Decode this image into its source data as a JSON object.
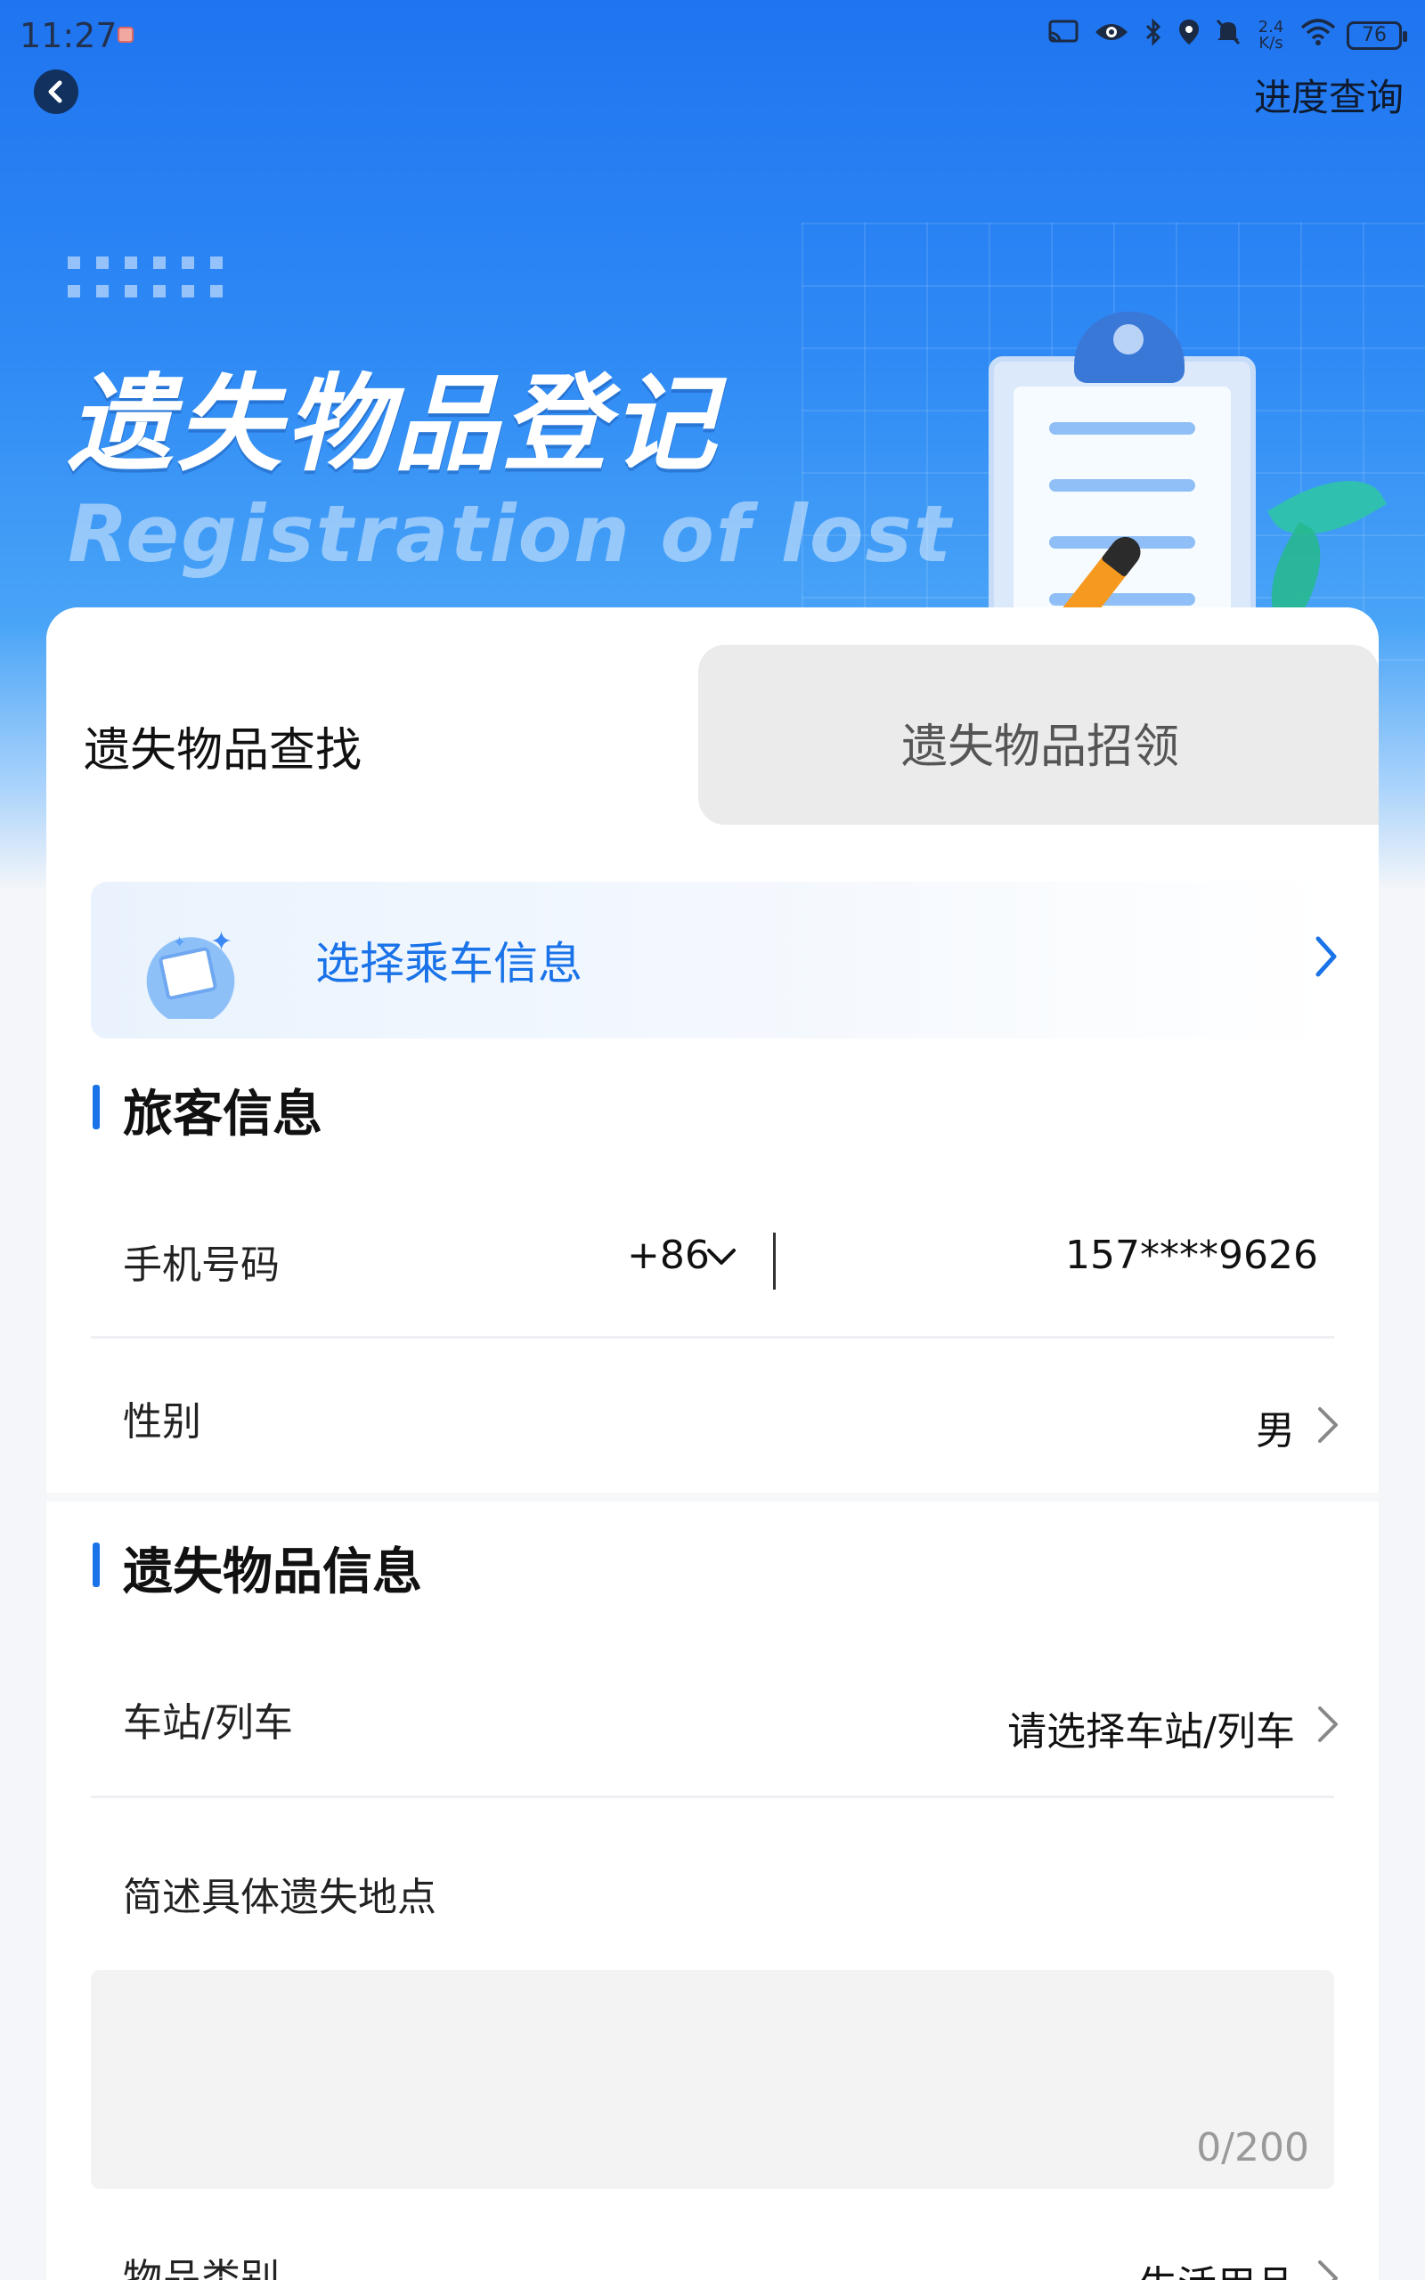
{
  "status_bar": {
    "time": "11:27",
    "speed": "2.4 K/s",
    "battery": "76",
    "icons": [
      "cast-icon",
      "eye-icon",
      "bluetooth-icon",
      "location-icon",
      "mute-icon",
      "wifi-icon"
    ]
  },
  "header": {
    "progress_query": "进度查询"
  },
  "hero": {
    "title": "遗失物品登记",
    "subtitle": "Registration  of  lost"
  },
  "tabs": [
    {
      "label": "遗失物品查找",
      "active": true
    },
    {
      "label": "遗失物品招领",
      "active": false
    }
  ],
  "trip": {
    "label": "选择乘车信息"
  },
  "passenger": {
    "section_title": "旅客信息",
    "phone_label": "手机号码",
    "country_code": "+86",
    "phone_value": "157****9626",
    "gender_label": "性别",
    "gender_value": "男"
  },
  "item": {
    "section_title": "遗失物品信息",
    "station_label": "车站/列车",
    "station_placeholder": "请选择车站/列车",
    "location_label": "简述具体遗失地点",
    "counter": "0/200",
    "category_label": "物品类别",
    "category_value": "生活用品"
  },
  "colors": {
    "accent": "#1a73e8",
    "hero_top": "#1f74f0",
    "tab_inactive_bg": "#ebebeb"
  }
}
